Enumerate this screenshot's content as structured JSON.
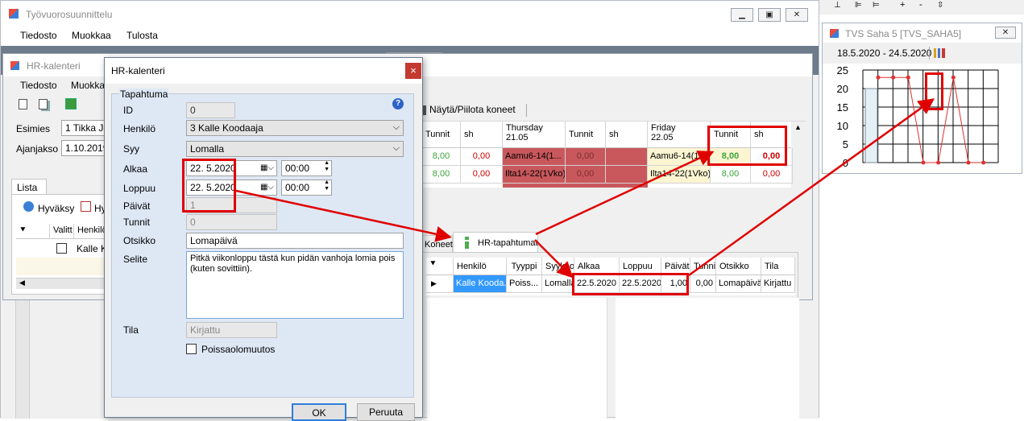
{
  "main_window": {
    "title": "Työvuorosuunnittelu",
    "menu": [
      "Tiedosto",
      "Muokkaa",
      "Tulosta"
    ]
  },
  "hr_window": {
    "title": "HR-kalenteri",
    "menu": [
      "Tiedosto",
      "Muokka"
    ],
    "esimies_label": "Esimies",
    "esimies_value": "1 Tikka Jo",
    "ajanjakso_label": "Ajanjakso",
    "ajanjakso_value": "1.10.2019",
    "tab_lista": "Lista",
    "hyvaksy_label": "Hyväksy",
    "hyvaksy2_label": "Hy",
    "col_valitt": "Valitt",
    "col_henkilo": "Henkilö",
    "row_henkilo": "Kalle Ko"
  },
  "schedule": {
    "nayta_label": "Näytä/Piilota koneet",
    "headers": {
      "tunnit1": "Tunnit",
      "sh1": "sh",
      "day1": "Thursday",
      "date1": "21.05",
      "tunnit2": "Tunnit",
      "sh2": "sh",
      "day2": "Friday",
      "date2": "22.05",
      "tunnit3": "Tunnit",
      "sh3": "sh"
    },
    "rows": [
      {
        "tunnit_a": "8,00",
        "sh_a": "0,00",
        "shift1": "Aamu6-14(1...",
        "tunnit_b": "0,00",
        "shift2": "Aamu6-14(1...",
        "tunnit_c": "8,00",
        "sh_c": "0,00"
      },
      {
        "tunnit_a": "8,00",
        "sh_a": "0,00",
        "shift1": "Ilta14-22(1Vko)",
        "tunnit_b": "0,00",
        "shift2": "Ilta14-22(1Vko)",
        "tunnit_c": "8,00",
        "sh_c": "0,00"
      }
    ]
  },
  "hr_events": {
    "tab_koneet": "Koneet",
    "tab_hr": "HR-tapahtumat",
    "columns": [
      "Henkilö",
      "Tyyppi",
      "Syykoo",
      "Alkaa",
      "Loppuu",
      "Päivät",
      "Tunnit",
      "Otsikko",
      "Tila"
    ],
    "row": [
      "Kalle Kooda...",
      "Poiss...",
      "Lomalla",
      "22.5.2020",
      "22.5.2020",
      "1,00",
      "0,00",
      "Lomapäivä",
      "Kirjattu"
    ]
  },
  "dialog": {
    "title": "HR-kalenteri",
    "close": "×",
    "group": "Tapahtuma",
    "id_label": "ID",
    "id_value": "0",
    "henkilo_label": "Henkilö",
    "henkilo_value": "3 Kalle Koodaaja",
    "syy_label": "Syy",
    "syy_value": "Lomalla",
    "alkaa_label": "Alkaa",
    "alkaa_date": "22.  5.2020",
    "alkaa_time": "00:00",
    "loppuu_label": "Loppuu",
    "loppuu_date": "22.  5.2020",
    "loppuu_time": "00:00",
    "paivat_label": "Päivät",
    "paivat_value": "1",
    "tunnit_label": "Tunnit",
    "tunnit_value": "0",
    "otsikko_label": "Otsikko",
    "otsikko_value": "Lomapäivä",
    "selite_label": "Selite",
    "selite_value": "Pitkä viikonloppu tästä kun pidän vanhoja lomia pois (kuten sovittiin).",
    "tila_label": "Tila",
    "tila_value": "Kirjattu",
    "poissaolo_label": "Poissaolomuutos",
    "ok": "OK",
    "peruuta": "Peruuta"
  },
  "chart_window": {
    "title": "TVS Saha 5 [TVS_SAHA5]",
    "period": "18.5.2020 - 24.5.2020"
  },
  "chart_data": {
    "type": "bar",
    "yticks": [
      "25",
      "20",
      "15",
      "10",
      "5",
      "0"
    ],
    "ylim": [
      0,
      25
    ],
    "bars": [
      20
    ],
    "line_points": [
      null,
      23,
      23,
      23,
      0,
      0,
      23,
      0,
      0
    ]
  },
  "colors": {
    "accent_red": "#e00000",
    "shift_red": "#c8585c",
    "shift_yellow": "#fcf5d2",
    "green_text": "#3aa53a",
    "red_text": "#cc0000"
  }
}
